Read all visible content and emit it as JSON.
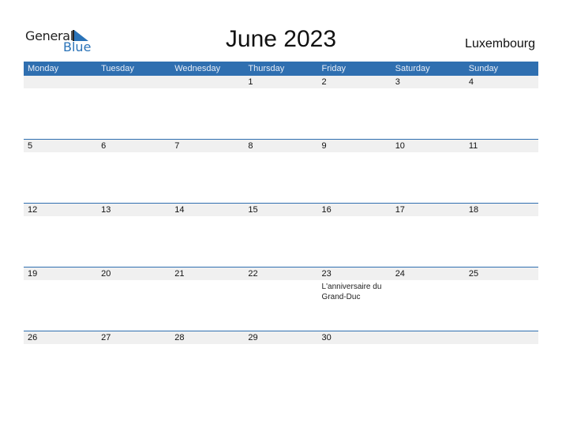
{
  "logo": {
    "line1": "General",
    "line2": "Blue"
  },
  "title": "June 2023",
  "country": "Luxembourg",
  "weekdays": [
    "Monday",
    "Tuesday",
    "Wednesday",
    "Thursday",
    "Friday",
    "Saturday",
    "Sunday"
  ],
  "weeks": [
    {
      "days": [
        "",
        "",
        "",
        "1",
        "2",
        "3",
        "4"
      ],
      "events": [
        "",
        "",
        "",
        "",
        "",
        "",
        ""
      ]
    },
    {
      "days": [
        "5",
        "6",
        "7",
        "8",
        "9",
        "10",
        "11"
      ],
      "events": [
        "",
        "",
        "",
        "",
        "",
        "",
        ""
      ]
    },
    {
      "days": [
        "12",
        "13",
        "14",
        "15",
        "16",
        "17",
        "18"
      ],
      "events": [
        "",
        "",
        "",
        "",
        "",
        "",
        ""
      ]
    },
    {
      "days": [
        "19",
        "20",
        "21",
        "22",
        "23",
        "24",
        "25"
      ],
      "events": [
        "",
        "",
        "",
        "",
        "L'anniversaire du Grand-Duc",
        "",
        ""
      ]
    },
    {
      "days": [
        "26",
        "27",
        "28",
        "29",
        "30",
        "",
        ""
      ],
      "events": [
        "",
        "",
        "",
        "",
        "",
        "",
        ""
      ]
    }
  ],
  "colors": {
    "accent": "#2f6fb0",
    "date_strip": "#f0f0f0"
  }
}
